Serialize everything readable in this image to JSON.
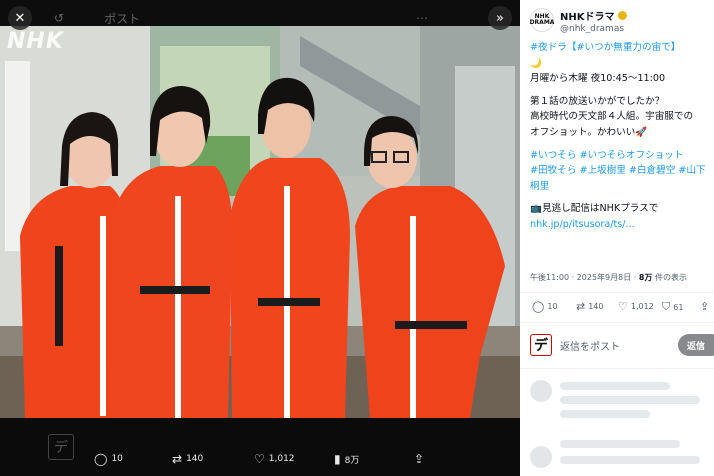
{
  "viewer": {
    "close_icon": "close-icon",
    "expand_icon": "double-chevron-right-icon",
    "ghost_header_text": "ポスト",
    "photo_logo": "NHK",
    "actions": {
      "replies": "10",
      "reposts": "140",
      "likes": "1,012",
      "views": "8万"
    }
  },
  "post": {
    "avatar_text": "NHK DRAMA",
    "display_name": "NHKドラマ",
    "handle": "@nhk_dramas",
    "lines": [
      "#夜ドラ【#いつか無重力の宙で】",
      "🌙",
      "月曜から木曜 夜10:45～11:00",
      "",
      "第１話の放送いかがでしたか？",
      "高校時代の天文部４人組。宇宙服での",
      "オフショット。かわいい🚀",
      "",
      "#いつそら #いつそらオフショット",
      "#田牧そら #上坂樹里 #白倉碧空 #山下",
      "桐里",
      "",
      "📺見逃し配信はNHKプラスで",
      "nhk.jp/p/itsusora/ts/..."
    ],
    "timestamp": "午後11:00 · 2025年9月8日 · ",
    "views_count": "8万",
    "views_label": " 件の表示",
    "stats": {
      "replies": "10",
      "reposts": "140",
      "likes": "1,012",
      "bookmarks": "61"
    },
    "reply": {
      "avatar_glyph": "デ",
      "placeholder": "返信をポスト",
      "button": "返信"
    }
  },
  "colors": {
    "accent": "#1d9bf0",
    "verified": "#e8b617",
    "spacesuit": "#f0441c"
  }
}
